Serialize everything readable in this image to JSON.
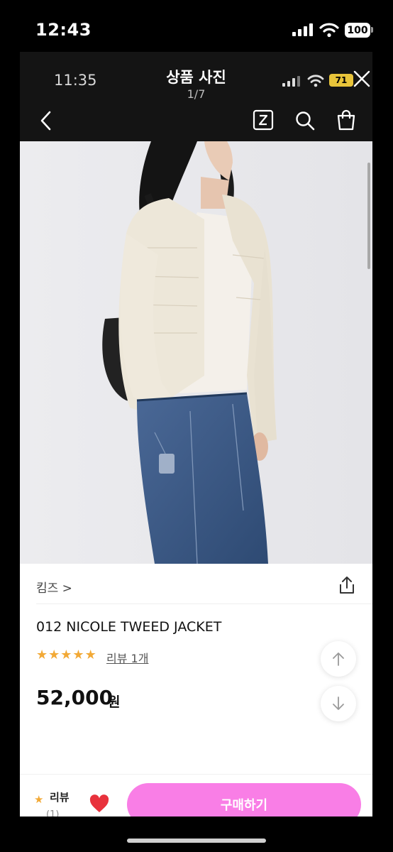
{
  "device": {
    "time": "12:43",
    "battery": "100",
    "icons": [
      "cellular-signal-icon",
      "wifi-icon",
      "battery-icon"
    ]
  },
  "screenshot": {
    "time": "11:35",
    "battery": "71",
    "icons": [
      "cellular-signal-icon",
      "wifi-icon",
      "battery-charging-icon"
    ]
  },
  "header": {
    "title": "상품 사진",
    "counter": "1/7",
    "icons": [
      "close-icon",
      "back-icon",
      "zigzag-z-icon",
      "search-icon",
      "shopping-bag-icon"
    ]
  },
  "product": {
    "brand": "킴즈 >",
    "name": "012 NICOLE TWEED JACKET",
    "rating_stars": 5,
    "review_link": "리뷰 1개",
    "price": "52,000",
    "currency": "원"
  },
  "bottom_bar": {
    "review_label": "리뷰",
    "review_count": "(1)",
    "buy_label": "구매하기",
    "icons": [
      "star-icon",
      "heart-icon"
    ]
  },
  "colors": {
    "header_bg": "#141414",
    "buy_button": "#f97ee6",
    "star": "#f2a936",
    "heart": "#e8323c",
    "inner_battery": "#e8c43a"
  }
}
